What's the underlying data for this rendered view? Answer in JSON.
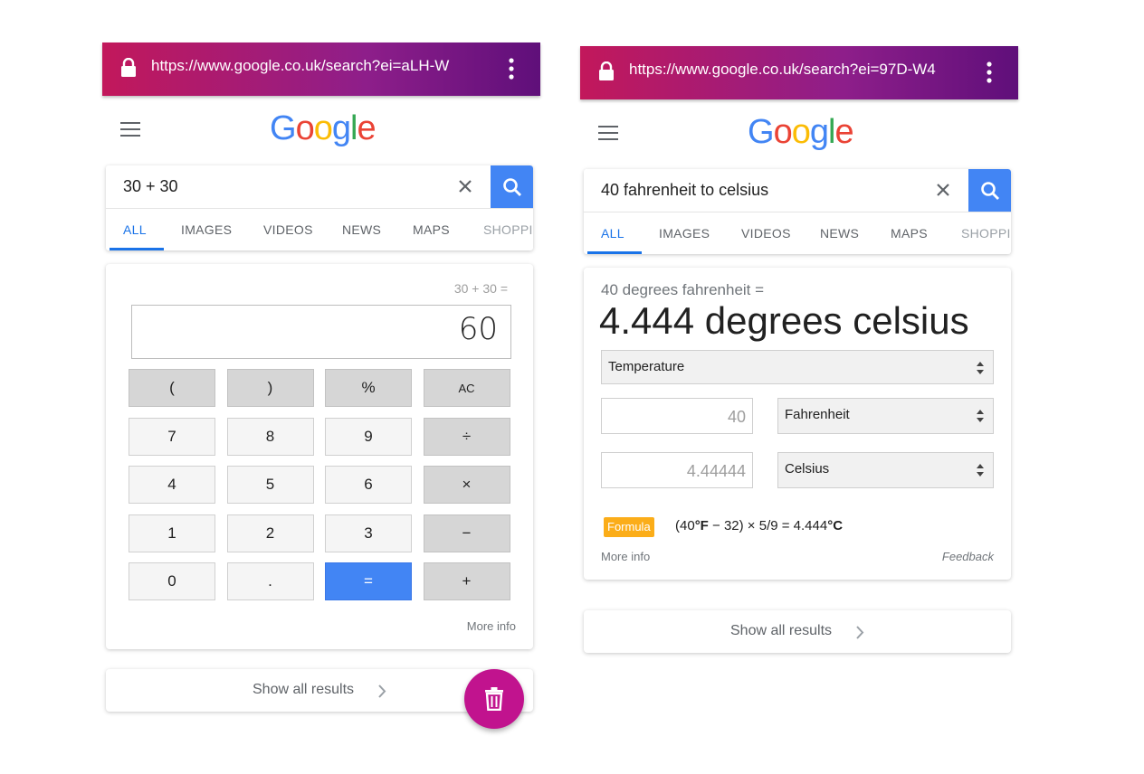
{
  "left_screen": {
    "url": "https://www.google.co.uk/search?ei=aLH-W",
    "logo": "Google",
    "query": "30 + 30",
    "tabs": [
      "ALL",
      "IMAGES",
      "VIDEOS",
      "NEWS",
      "MAPS",
      "SHOPPI"
    ],
    "active_tab": "ALL",
    "calculator": {
      "expression": "30 + 30 =",
      "result": "60",
      "keys": [
        "(",
        ")",
        "%",
        "AC",
        "7",
        "8",
        "9",
        "÷",
        "4",
        "5",
        "6",
        "×",
        "1",
        "2",
        "3",
        "−",
        "0",
        ".",
        "=",
        "+"
      ],
      "more_info": "More info"
    },
    "show_all": "Show all results",
    "fab_icon": "trash-icon"
  },
  "right_screen": {
    "url": "https://www.google.co.uk/search?ei=97D-W4",
    "logo": "Google",
    "query": "40 fahrenheit to celsius",
    "tabs": [
      "ALL",
      "IMAGES",
      "VIDEOS",
      "NEWS",
      "MAPS",
      "SHOPPI"
    ],
    "active_tab": "ALL",
    "converter": {
      "subtitle": "40 degrees fahrenheit =",
      "result": "4.444 degrees celsius",
      "unit_type": "Temperature",
      "from_value": "40",
      "from_unit": "Fahrenheit",
      "to_value": "4.44444",
      "to_unit": "Celsius",
      "formula_label": "Formula",
      "formula_prefix": "(40",
      "formula_unit_from": "°F",
      "formula_middle": " − 32) × 5/9 = 4.444",
      "formula_unit_to": "°C",
      "more_info": "More info",
      "feedback": "Feedback"
    },
    "show_all": "Show all results"
  },
  "colors": {
    "brand_blue": "#4285f4",
    "url_gradient_start": "#c2185b",
    "url_gradient_end": "#5f0f7a",
    "fab": "#c1138e",
    "formula_badge": "#fbad19"
  }
}
